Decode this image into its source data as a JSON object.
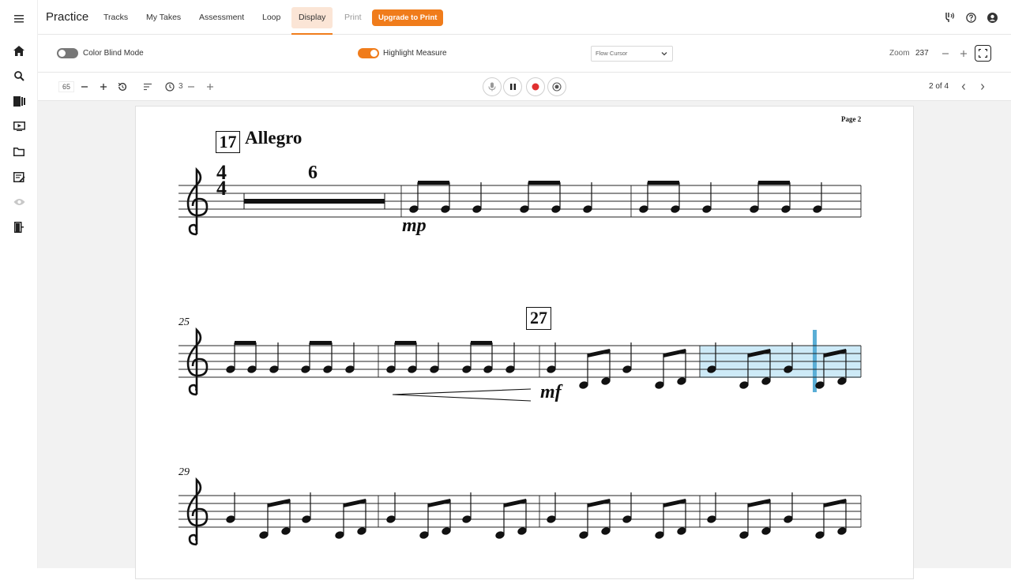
{
  "app": {
    "brand": "Practice"
  },
  "nav": {
    "items": [
      {
        "label": "Tracks"
      },
      {
        "label": "My Takes"
      },
      {
        "label": "Assessment"
      },
      {
        "label": "Loop"
      },
      {
        "label": "Display"
      },
      {
        "label": "Print"
      }
    ],
    "active": "Display",
    "upgrade_label": "Upgrade to Print"
  },
  "sidebar": {
    "items": [
      {
        "icon": "menu-icon"
      },
      {
        "icon": "home-icon"
      },
      {
        "icon": "search-icon"
      },
      {
        "icon": "library-icon"
      },
      {
        "icon": "video-icon"
      },
      {
        "icon": "folder-icon"
      },
      {
        "icon": "assignment-icon"
      },
      {
        "icon": "eye-icon"
      },
      {
        "icon": "exit-icon"
      }
    ]
  },
  "options": {
    "color_blind": {
      "label": "Color Blind Mode",
      "on": false
    },
    "highlight": {
      "label": "Highlight Measure",
      "on": true
    },
    "cursor_select": {
      "value": "Flow Cursor"
    },
    "zoom_label": "Zoom",
    "zoom_value": "237"
  },
  "controls": {
    "tempo": "65",
    "count_in": "3",
    "pager": "2 of 4"
  },
  "colors": {
    "accent": "#f07c1b",
    "highlight": "#cdeaf7",
    "cursor": "#5aaed6",
    "record": "#e03030"
  },
  "score": {
    "page_label": "Page 2",
    "rehearsal_marks": [
      "17",
      "27"
    ],
    "tempo_marking": "Allegro",
    "time_signature": {
      "top": "4",
      "bottom": "4"
    },
    "multirest_count": "6",
    "dynamics": [
      "mp",
      "mf"
    ],
    "measure_numbers": [
      "25",
      "29"
    ]
  }
}
